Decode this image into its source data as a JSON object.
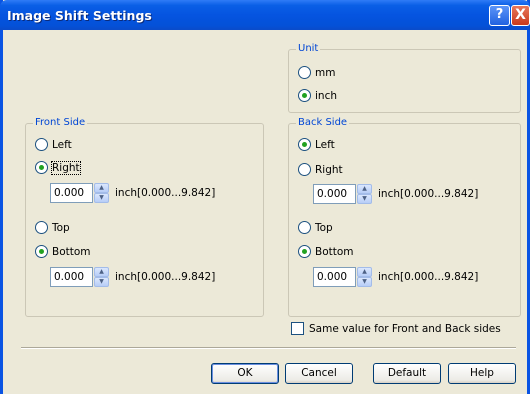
{
  "window": {
    "title": "Image Shift Settings",
    "help_button": "?",
    "close_button": "X"
  },
  "unit": {
    "legend": "Unit",
    "options": [
      {
        "label": "mm",
        "selected": false
      },
      {
        "label": "inch",
        "selected": true
      }
    ]
  },
  "front": {
    "legend": "Front Side",
    "horizontal": [
      {
        "label": "Left",
        "selected": false
      },
      {
        "label": "Right",
        "selected": true
      }
    ],
    "horizontal_value": "0.000",
    "vertical": [
      {
        "label": "Top",
        "selected": false
      },
      {
        "label": "Bottom",
        "selected": true
      }
    ],
    "vertical_value": "0.000",
    "range_label": "inch[0.000...9.842]"
  },
  "back": {
    "legend": "Back Side",
    "horizontal": [
      {
        "label": "Left",
        "selected": true
      },
      {
        "label": "Right",
        "selected": false
      }
    ],
    "horizontal_value": "0.000",
    "vertical": [
      {
        "label": "Top",
        "selected": false
      },
      {
        "label": "Bottom",
        "selected": true
      }
    ],
    "vertical_value": "0.000",
    "range_label": "inch[0.000...9.842]"
  },
  "same_value": {
    "label": "Same value for Front and Back sides",
    "checked": false
  },
  "buttons": {
    "ok": "OK",
    "cancel": "Cancel",
    "default": "Default",
    "help": "Help"
  },
  "icons": {
    "spin_up": "spin-up-icon",
    "spin_down": "spin-down-icon"
  },
  "colors": {
    "titlebar": "#0554e0",
    "legend": "#0046d5",
    "radio_dot": "#21a121",
    "dialog_bg": "#ece9d8"
  }
}
